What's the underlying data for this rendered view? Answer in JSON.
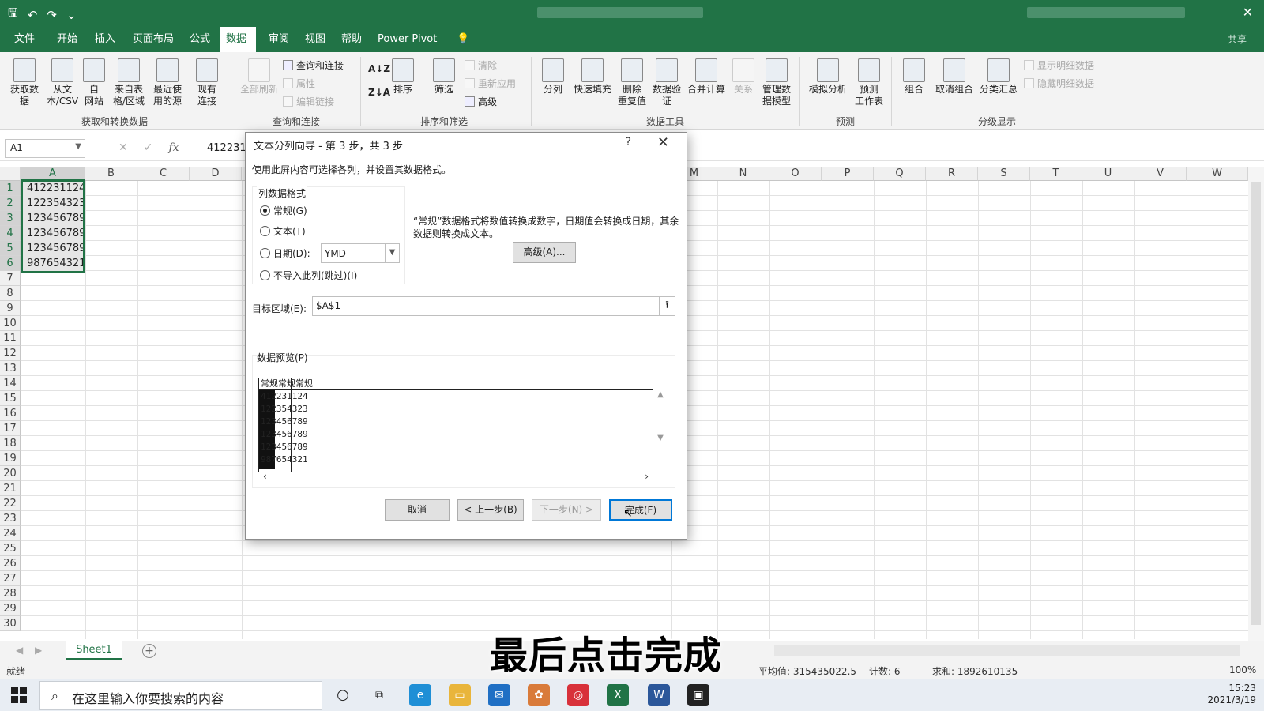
{
  "ribbon_tabs": [
    "文件",
    "开始",
    "插入",
    "页面布局",
    "公式",
    "数据",
    "审阅",
    "视图",
    "帮助",
    "Power Pivot"
  ],
  "active_tab": "数据",
  "share_label": "共享",
  "ribbon": {
    "get_data": "获取数\n据",
    "from_text": "从文\n本/CSV",
    "from_web": "自\n网站",
    "from_table": "来自表\n格/区域",
    "recent": "最近使\n用的源",
    "existing": "现有\n连接",
    "refresh_all": "全部刷新",
    "queries": "查询和连接",
    "properties": "属性",
    "edit_links": "编辑链接",
    "sort": "排序",
    "filter": "筛选",
    "clear": "清除",
    "reapply": "重新应用",
    "advanced": "高级",
    "text_to_columns": "分列",
    "flash_fill": "快速填充",
    "remove_dup": "删除\n重复值",
    "validation": "数据验\n证",
    "consolidate": "合并计算",
    "relations": "关系",
    "data_model": "管理数\n据模型",
    "whatif": "模拟分析",
    "forecast": "预测\n工作表",
    "group": "组合",
    "ungroup": "取消组合",
    "subtotal": "分类汇总",
    "show_detail": "显示明细数据",
    "hide_detail": "隐藏明细数据",
    "groups": {
      "get_transform": "获取和转换数据",
      "query_conn": "查询和连接",
      "sort_filter": "排序和筛选",
      "data_tools": "数据工具",
      "forecast": "预测",
      "outline": "分级显示"
    }
  },
  "formula_bar": {
    "name_box": "A1",
    "fx": "fx",
    "value": "412231"
  },
  "columns": [
    "A",
    "B",
    "C",
    "D",
    "M",
    "N",
    "O",
    "P",
    "Q",
    "R",
    "S",
    "T",
    "U",
    "V",
    "W"
  ],
  "rows": [
    "1",
    "2",
    "3",
    "4",
    "5",
    "6",
    "7",
    "8",
    "9",
    "10",
    "11",
    "12",
    "13",
    "14",
    "15",
    "16",
    "17",
    "18",
    "19",
    "20",
    "21",
    "22",
    "23",
    "24",
    "25",
    "26",
    "27",
    "28",
    "29",
    "30"
  ],
  "cells": [
    "412231124",
    "122354323",
    "123456789",
    "123456789",
    "123456789",
    "987654321"
  ],
  "sheet_tab": "Sheet1",
  "status": {
    "ready": "就绪",
    "average": "平均值: 315435022.5",
    "count": "计数: 6",
    "sum": "求和: 1892610135",
    "zoom": "100%"
  },
  "caption": "最后点击完成",
  "taskbar": {
    "search_placeholder": "在这里输入你要搜索的内容",
    "time": "15:23",
    "date": "2021/3/19"
  },
  "dialog": {
    "title": "文本分列向导 - 第 3 步，共 3 步",
    "help": "?",
    "close": "✕",
    "description": "使用此屏内容可选择各列，并设置其数据格式。",
    "format_group_label": "列数据格式",
    "opt_general": "常规(G)",
    "opt_text": "文本(T)",
    "opt_date": "日期(D):",
    "date_value": "YMD",
    "opt_skip": "不导入此列(跳过)(I)",
    "note": "“常规”数据格式将数值转换成数字，日期值会转换成日期，其余数据则转换成文本。",
    "advanced_btn": "高级(A)...",
    "dest_label": "目标区域(E):",
    "dest_value": "$A$1",
    "preview_label": "数据预览(P)",
    "preview_header": "常规常规常规",
    "preview_rows": [
      "412231124",
      "122354323",
      "123456789",
      "123456789",
      "123456789",
      "987654321"
    ],
    "btn_cancel": "取消",
    "btn_back": "< 上一步(B)",
    "btn_next": "下一步(N) >",
    "btn_finish": "完成(F)"
  },
  "colors": {
    "excel_green": "#217346",
    "default_button_border": "#0078d7"
  }
}
